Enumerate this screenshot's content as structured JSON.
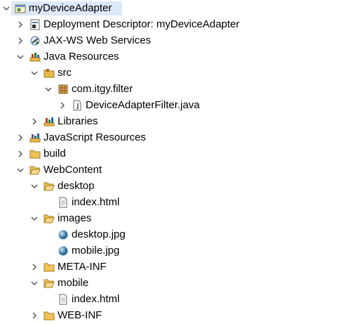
{
  "tree": {
    "project": "myDeviceAdapter",
    "deployment_descriptor": "Deployment Descriptor: myDeviceAdapter",
    "jaxws": "JAX-WS Web Services",
    "java_resources": "Java Resources",
    "src": "src",
    "package": "com.itgy.filter",
    "java_file": "DeviceAdapterFilter.java",
    "libraries": "Libraries",
    "js_resources": "JavaScript Resources",
    "build": "build",
    "webcontent": "WebContent",
    "desktop": "desktop",
    "desktop_index": "index.html",
    "images": "images",
    "desktop_jpg": "desktop.jpg",
    "mobile_jpg": "mobile.jpg",
    "meta_inf": "META-INF",
    "mobile": "mobile",
    "mobile_index": "index.html",
    "web_inf": "WEB-INF"
  },
  "colors": {
    "selection": "#dbe8f7",
    "folder": "#e8b64a",
    "twisty": "#555555"
  }
}
